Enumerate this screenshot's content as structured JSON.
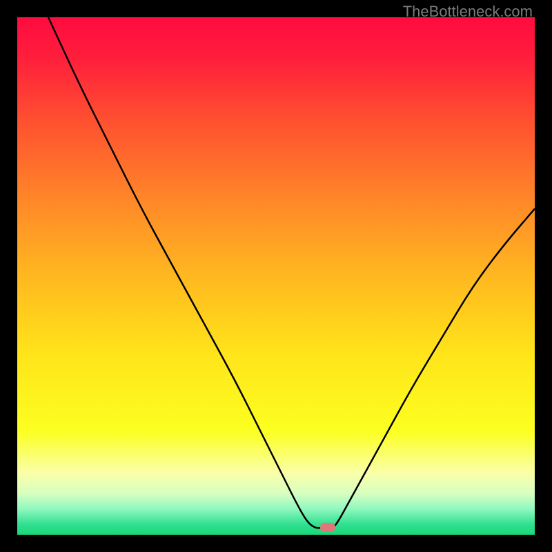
{
  "watermark": "TheBottleneck.com",
  "chart_data": {
    "type": "line",
    "title": "",
    "xlabel": "",
    "ylabel": "",
    "xlim": [
      0,
      100
    ],
    "ylim": [
      0,
      100
    ],
    "background_gradient": {
      "stops": [
        {
          "offset": 0,
          "color": "#ff0b3f"
        },
        {
          "offset": 8,
          "color": "#ff1f3c"
        },
        {
          "offset": 20,
          "color": "#ff5030"
        },
        {
          "offset": 35,
          "color": "#ff8628"
        },
        {
          "offset": 50,
          "color": "#ffb820"
        },
        {
          "offset": 65,
          "color": "#ffe41a"
        },
        {
          "offset": 80,
          "color": "#fcff20"
        },
        {
          "offset": 88,
          "color": "#faffa8"
        },
        {
          "offset": 92,
          "color": "#d8ffc0"
        },
        {
          "offset": 95,
          "color": "#90f8c0"
        },
        {
          "offset": 98,
          "color": "#30e090"
        },
        {
          "offset": 100,
          "color": "#18d878"
        }
      ]
    },
    "series": [
      {
        "name": "bottleneck-curve",
        "points_xy": [
          [
            6,
            100
          ],
          [
            12,
            87
          ],
          [
            18,
            75
          ],
          [
            24,
            63
          ],
          [
            30,
            52
          ],
          [
            36,
            41
          ],
          [
            42,
            30
          ],
          [
            47,
            20
          ],
          [
            51,
            12
          ],
          [
            54,
            6
          ],
          [
            56,
            2.5
          ],
          [
            57.5,
            1.3
          ],
          [
            59,
            1.3
          ],
          [
            60,
            1.3
          ],
          [
            61,
            1.3
          ],
          [
            62,
            2.5
          ],
          [
            65,
            8
          ],
          [
            70,
            17
          ],
          [
            76,
            28
          ],
          [
            82,
            38
          ],
          [
            88,
            48
          ],
          [
            94,
            56
          ],
          [
            100,
            63
          ]
        ]
      }
    ],
    "marker": {
      "x": 60,
      "y": 1.5,
      "color": "#e07878"
    }
  }
}
